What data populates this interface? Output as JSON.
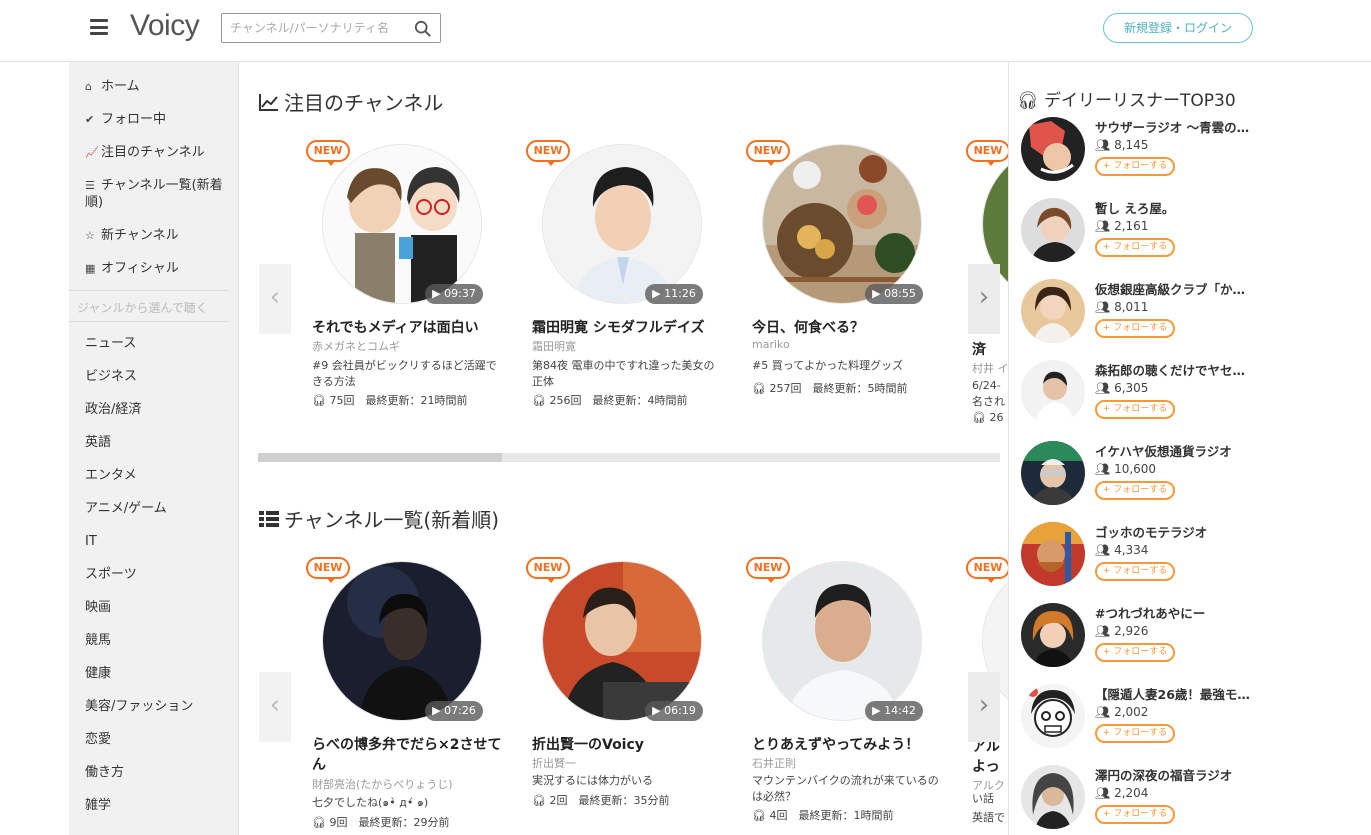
{
  "header": {
    "logo": "Voicy",
    "search_placeholder": "チャンネル/パーソナリティ名",
    "login_label": "新規登録・ログイン"
  },
  "sidebar": {
    "nav": [
      {
        "icon": "home-icon",
        "label": "ホーム"
      },
      {
        "icon": "check-icon",
        "label": "フォロー中"
      },
      {
        "icon": "trend-icon",
        "label": "注目のチャンネル"
      },
      {
        "icon": "list-icon",
        "label": "チャンネル一覧(新着順)"
      },
      {
        "icon": "star-icon",
        "label": "新チャンネル"
      },
      {
        "icon": "building-icon",
        "label": "オフィシャル"
      }
    ],
    "genre_heading": "ジャンルから選んで聴く",
    "genres": [
      "ニュース",
      "ビジネス",
      "政治/経済",
      "英語",
      "エンタメ",
      "アニメ/ゲーム",
      "IT",
      "スポーツ",
      "映画",
      "競馬",
      "健康",
      "美容/ファッション",
      "恋愛",
      "働き方",
      "雑学"
    ]
  },
  "featured": {
    "title": "注目のチャンネル",
    "cards": [
      {
        "badge": "NEW",
        "duration": "▶ 09:37",
        "title": "それでもメディアは面白い",
        "author": "赤メガネとコムギ",
        "episode": "#9 会社員がビックリするほど活躍できる方法",
        "stats": "75回　最終更新：21時間前"
      },
      {
        "badge": "NEW",
        "duration": "▶ 11:26",
        "title": "霜田明寛 シモダフルデイズ",
        "author": "霜田明寛",
        "episode": "第84夜 電車の中ですれ違った美女の正体",
        "stats": "256回　最終更新：4時間前"
      },
      {
        "badge": "NEW",
        "duration": "▶ 08:55",
        "title": "今日、何食べる？",
        "author": "mariko",
        "episode": "#5 買ってよかった料理グッズ",
        "stats": "257回　最終更新：5時間前"
      },
      {
        "badge": "NEW",
        "title_partial": "済",
        "author_partial": "村井 イ",
        "episode_partial": "6/24-\n名され",
        "stats_partial": "26"
      }
    ]
  },
  "newest": {
    "title": "チャンネル一覧(新着順)",
    "cards": [
      {
        "badge": "NEW",
        "duration": "▶ 07:26",
        "title": "らべの博多弁でだら×2させてん",
        "author": "財部亮治(たからべりょうじ)",
        "episode": "七夕でしたね(๑•̀ д•́ ๑)",
        "stats": "9回　最終更新：29分前"
      },
      {
        "badge": "NEW",
        "duration": "▶ 06:19",
        "title": "折出賢一のVoicy",
        "author": "折出賢一",
        "episode": "実況するには体力がいる",
        "stats": "2回　最終更新：35分前"
      },
      {
        "badge": "NEW",
        "duration": "▶ 14:42",
        "title": "とりあえずやってみよう！",
        "author": "石井正則",
        "episode": "マウンテンバイクの流れが来ているのは必然？",
        "stats": "4回　最終更新：1時間前"
      },
      {
        "badge": "NEW",
        "title_partial": "アル\nよっ",
        "author_partial": "アルク",
        "episode_partial": "い話",
        "stats_partial": "英語で"
      }
    ]
  },
  "ranking": {
    "title": "デイリーリスナーTOP30",
    "follow_label": "+ フォローする",
    "items": [
      {
        "name": "サウザーラジオ ～青雲の…",
        "count": "8,145"
      },
      {
        "name": "暫し えろ屋。",
        "count": "2,161"
      },
      {
        "name": "仮想銀座高級クラブ「か…",
        "count": "8,011"
      },
      {
        "name": "森拓郎の聴くだけでヤセ…",
        "count": "6,305"
      },
      {
        "name": "イケハヤ仮想通貨ラジオ",
        "count": "10,600"
      },
      {
        "name": "ゴッホのモテラジオ",
        "count": "4,334"
      },
      {
        "name": "#つれづれあやにー",
        "count": "2,926"
      },
      {
        "name": "【隠遁人妻26歳！最強モ…",
        "count": "2,002"
      },
      {
        "name": "澤円の深夜の福音ラジオ",
        "count": "2,204"
      }
    ]
  }
}
